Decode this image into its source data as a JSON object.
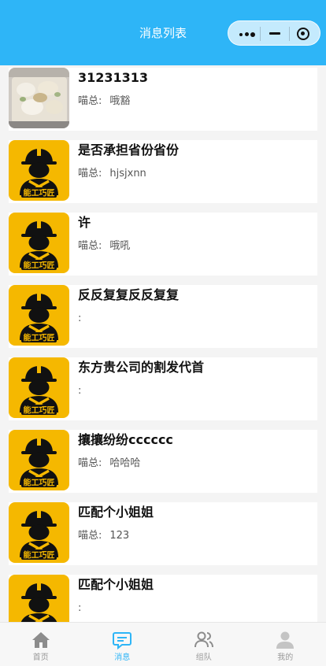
{
  "header": {
    "title": "消息列表"
  },
  "messages": [
    {
      "title": "31231313",
      "sender": "喵总:",
      "text": "哦豁",
      "avatar": "photo"
    },
    {
      "title": "是否承担省份省份",
      "sender": "喵总:",
      "text": "hjsjxnn",
      "avatar": "logo"
    },
    {
      "title": "许",
      "sender": "喵总:",
      "text": "哦吼",
      "avatar": "logo"
    },
    {
      "title": "反反复复反反复复",
      "sender": ":",
      "text": "",
      "avatar": "logo"
    },
    {
      "title": "东方贵公司的割发代首",
      "sender": ":",
      "text": "",
      "avatar": "logo"
    },
    {
      "title": "攘攘纷纷cccccc",
      "sender": "喵总:",
      "text": "哈哈哈",
      "avatar": "logo"
    },
    {
      "title": "匹配个小姐姐",
      "sender": "喵总:",
      "text": "123",
      "avatar": "logo"
    },
    {
      "title": "匹配个小姐姐",
      "sender": ":",
      "text": "",
      "avatar": "logo"
    }
  ],
  "logo_text": "能工巧匠",
  "tabs": [
    {
      "label": "首页",
      "icon": "home-icon",
      "active": false
    },
    {
      "label": "消息",
      "icon": "message-icon",
      "active": true
    },
    {
      "label": "组队",
      "icon": "team-icon",
      "active": false
    },
    {
      "label": "我的",
      "icon": "profile-icon",
      "active": false
    }
  ],
  "colors": {
    "accent": "#2eb5f7",
    "logo_bg": "#f5b800"
  }
}
